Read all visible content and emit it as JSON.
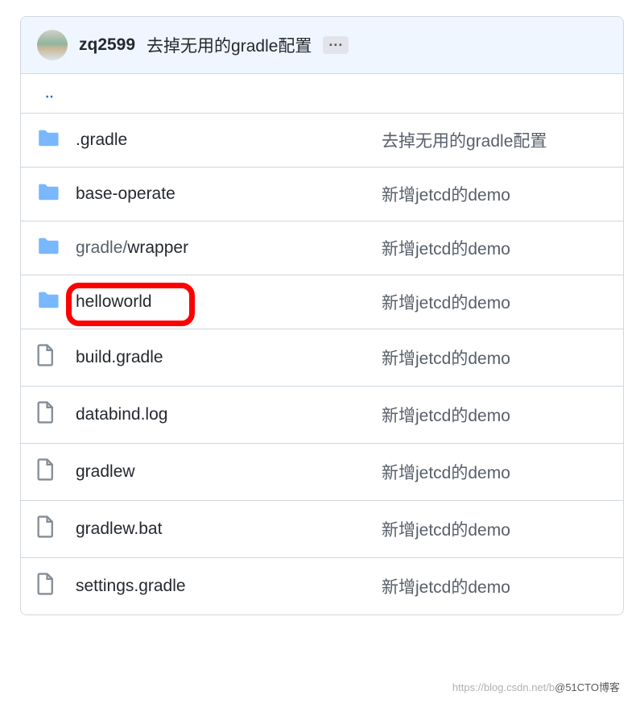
{
  "header": {
    "username": "zq2599",
    "commit_message": "去掉无用的gradle配置",
    "more_label": "···"
  },
  "parent_dir": "‥",
  "files": [
    {
      "type": "folder",
      "name": ".gradle",
      "message": "去掉无用的gradle配置",
      "highlighted": false
    },
    {
      "type": "folder",
      "name": "base-operate",
      "message": "新增jetcd的demo",
      "highlighted": false
    },
    {
      "type": "folder",
      "name_prefix": "gradle/",
      "name": "wrapper",
      "message": "新增jetcd的demo",
      "highlighted": false
    },
    {
      "type": "folder",
      "name": "helloworld",
      "message": "新增jetcd的demo",
      "highlighted": true
    },
    {
      "type": "file",
      "name": "build.gradle",
      "message": "新增jetcd的demo",
      "highlighted": false
    },
    {
      "type": "file",
      "name": "databind.log",
      "message": "新增jetcd的demo",
      "highlighted": false
    },
    {
      "type": "file",
      "name": "gradlew",
      "message": "新增jetcd的demo",
      "highlighted": false
    },
    {
      "type": "file",
      "name": "gradlew.bat",
      "message": "新增jetcd的demo",
      "highlighted": false
    },
    {
      "type": "file",
      "name": "settings.gradle",
      "message": "新增jetcd的demo",
      "highlighted": false
    }
  ],
  "watermark": {
    "faded": "https://blog.csdn.net/b",
    "dark": "@51CTO博客"
  }
}
